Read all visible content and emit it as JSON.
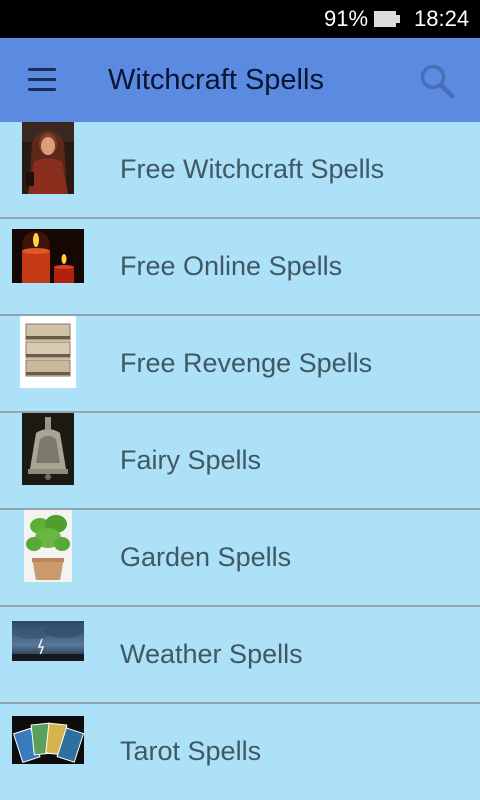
{
  "status_bar": {
    "battery_percent": "91%",
    "time": "18:24"
  },
  "app_bar": {
    "title": "Witchcraft Spells",
    "menu_icon": "hamburger-menu-icon",
    "search_icon": "search-icon"
  },
  "colors": {
    "app_bar": "#5a8be0",
    "list_background": "#ade1f8",
    "divider": "#8fa6b0",
    "label_text": "#3f5863",
    "title_text": "#0b1433"
  },
  "items": [
    {
      "label": "Free Witchcraft Spells",
      "image": "witch-portrait-thumbnail"
    },
    {
      "label": "Free Online Spells",
      "image": "candles-thumbnail"
    },
    {
      "label": "Free Revenge Spells",
      "image": "stacked-boxes-thumbnail"
    },
    {
      "label": "Fairy Spells",
      "image": "bell-thumbnail"
    },
    {
      "label": "Garden Spells",
      "image": "potted-herb-thumbnail"
    },
    {
      "label": "Weather Spells",
      "image": "storm-sky-thumbnail"
    },
    {
      "label": "Tarot Spells",
      "image": "tarot-cards-thumbnail"
    }
  ]
}
